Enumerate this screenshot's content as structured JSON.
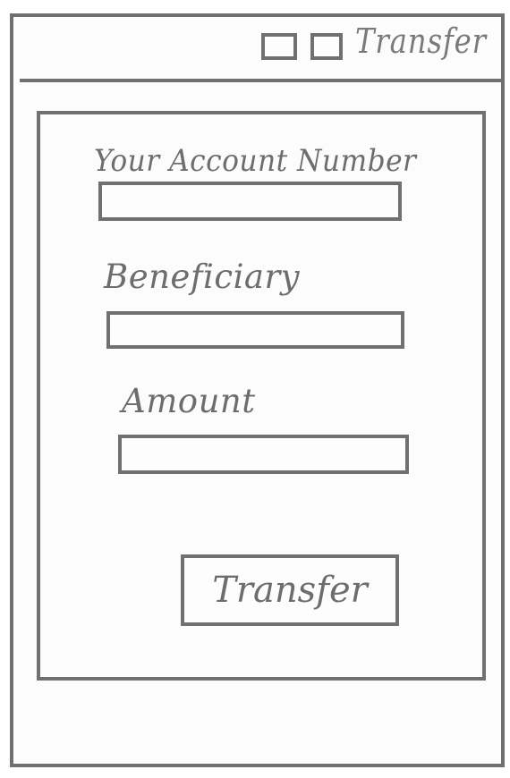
{
  "window": {
    "title": "Transfer"
  },
  "form": {
    "account_number": {
      "label": "Your Account Number",
      "value": "",
      "placeholder": ""
    },
    "beneficiary": {
      "label": "Beneficiary",
      "value": "",
      "placeholder": ""
    },
    "amount": {
      "label": "Amount",
      "value": "",
      "placeholder": ""
    },
    "submit_label": "Transfer"
  },
  "colors": {
    "stroke": "#707070",
    "background": "#fcfcfc"
  }
}
